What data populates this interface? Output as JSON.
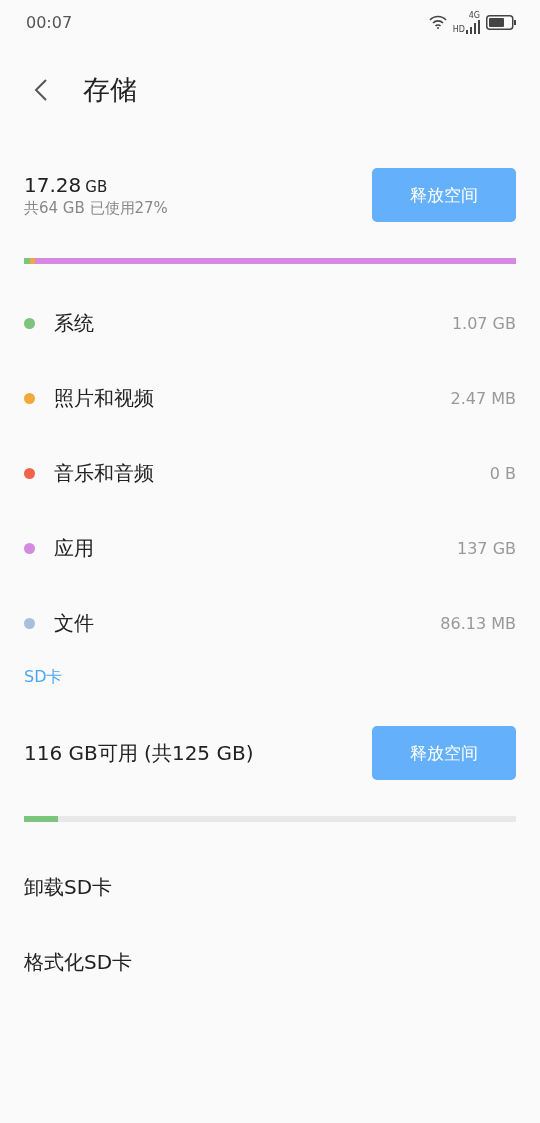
{
  "status_bar": {
    "time": "00:07",
    "hd": "HD",
    "network": "4G"
  },
  "header": {
    "title": "存储"
  },
  "internal": {
    "used": "17.28",
    "unit": "GB",
    "summary": "共64 GB 已使用27%",
    "button": "释放空间",
    "segments": [
      {
        "color": "#7dc47f",
        "level": 0.012
      },
      {
        "color": "#f2a93b",
        "level": 0.01
      },
      {
        "color": "#d48ae0",
        "level": 0.978
      }
    ]
  },
  "categories": [
    {
      "name": "系统",
      "size": "1.07 GB",
      "color": "#7dc47f"
    },
    {
      "name": "照片和视频",
      "size": "2.47 MB",
      "color": "#f2a93b"
    },
    {
      "name": "音乐和音频",
      "size": "0 B",
      "color": "#f0654a"
    },
    {
      "name": "应用",
      "size": "137 GB",
      "color": "#d48ae0"
    },
    {
      "name": "文件",
      "size": "86.13 MB",
      "color": "#a5bfdc"
    }
  ],
  "sd_card": {
    "section": "SD卡",
    "summary": "116 GB可用 (共125 GB)",
    "button": "释放空间",
    "level": 0.07,
    "actions": [
      "卸载SD卡",
      "格式化SD卡"
    ]
  }
}
